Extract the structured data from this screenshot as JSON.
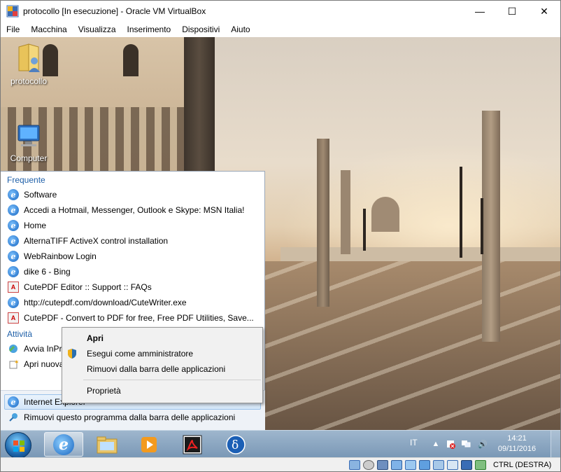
{
  "window": {
    "title": "protocollo [In esecuzione] - Oracle VM VirtualBox",
    "minimize": "—",
    "maximize": "☐",
    "close": "✕"
  },
  "menubar": [
    "File",
    "Macchina",
    "Visualizza",
    "Inserimento",
    "Dispositivi",
    "Aiuto"
  ],
  "desktop": {
    "icons": [
      {
        "label": "protocollo",
        "icon": "user-folder-icon"
      },
      {
        "label": "Computer",
        "icon": "computer-icon"
      }
    ]
  },
  "jumplist": {
    "frequent_header": "Frequente",
    "frequent": [
      {
        "label": "Software",
        "icon": "ie-page-icon"
      },
      {
        "label": "Accedi a Hotmail, Messenger, Outlook e Skype: MSN Italia!",
        "icon": "ie-page-icon"
      },
      {
        "label": "Home",
        "icon": "ie-page-icon"
      },
      {
        "label": "AlternaTIFF ActiveX control installation",
        "icon": "ie-page-icon"
      },
      {
        "label": "WebRainbow Login",
        "icon": "ie-page-icon"
      },
      {
        "label": "dike 6 - Bing",
        "icon": "ie-page-icon"
      },
      {
        "label": "CutePDF Editor :: Support :: FAQs",
        "icon": "pdf-page-icon"
      },
      {
        "label": "http://cutepdf.com/download/CuteWriter.exe",
        "icon": "ie-page-icon"
      },
      {
        "label": "CutePDF - Convert to PDF for free, Free PDF Utilities, Save...",
        "icon": "pdf-page-icon"
      }
    ],
    "tasks_header": "Attività",
    "tasks": [
      {
        "label": "Avvia InPri",
        "icon": "inprivate-icon"
      },
      {
        "label": "Apri nuova",
        "icon": "new-tab-icon"
      }
    ],
    "program": "Internet Explorer",
    "unpin": "Rimuovi questo programma dalla barra delle applicazioni"
  },
  "context_menu": {
    "items": [
      {
        "label": "Apri",
        "bold": true
      },
      {
        "label": "Esegui come amministratore",
        "icon": "uac-shield-icon"
      },
      {
        "label": "Rimuovi dalla barra delle applicazioni"
      }
    ],
    "properties": "Proprietà"
  },
  "taskbar": {
    "apps": [
      "internet-explorer-icon",
      "file-explorer-icon",
      "media-player-icon",
      "acrobat-icon",
      "dike-icon"
    ],
    "lang": "IT",
    "time": "14:21",
    "date": "09/11/2016"
  },
  "statusbar": {
    "host_key": "CTRL (DESTRA)"
  },
  "colors": {
    "accent": "#1e5fa8",
    "taskbar": "#8aa7c3"
  }
}
